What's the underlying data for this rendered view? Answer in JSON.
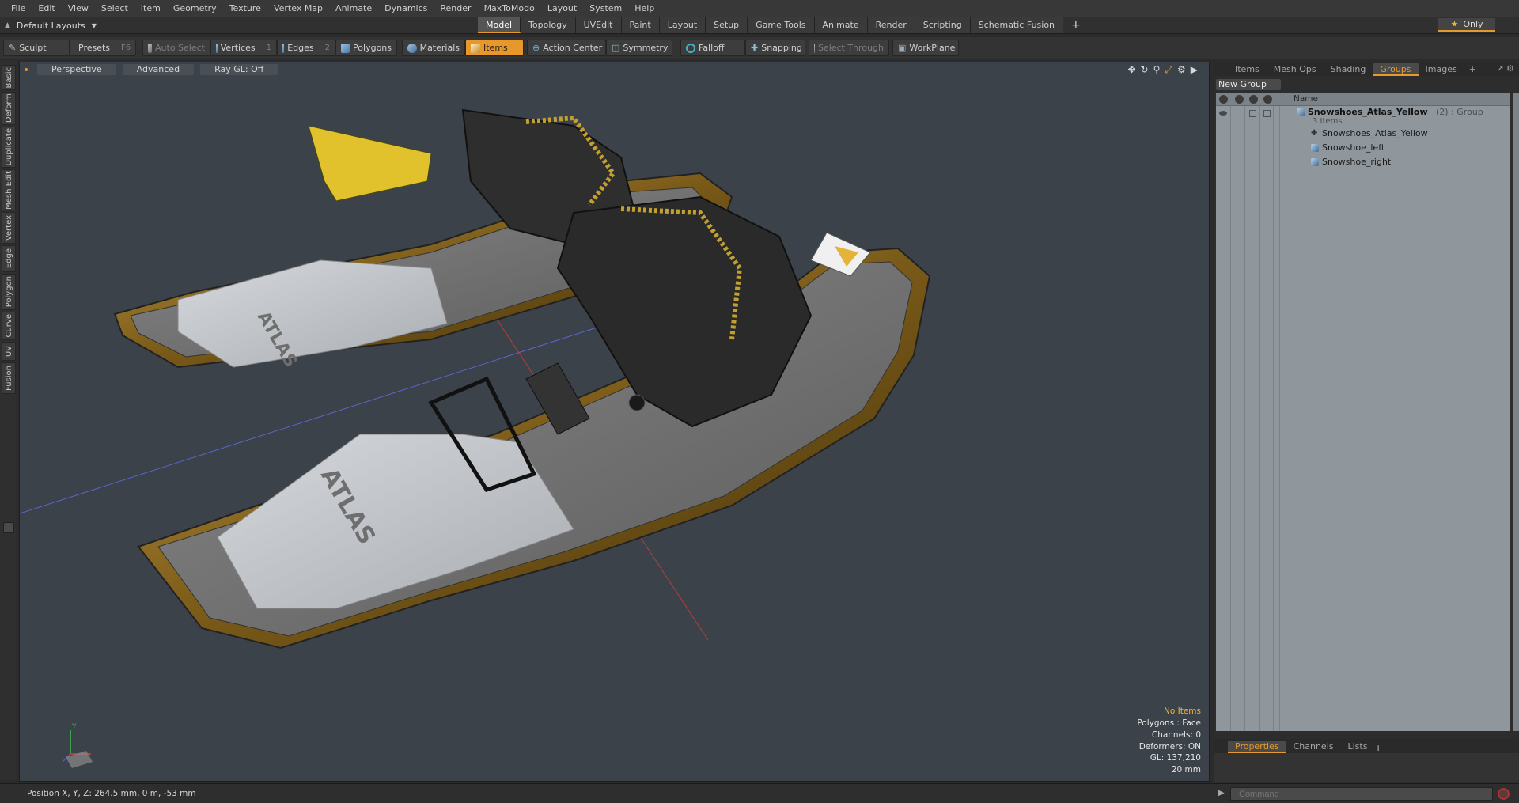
{
  "menu": [
    "File",
    "Edit",
    "View",
    "Select",
    "Item",
    "Geometry",
    "Texture",
    "Vertex Map",
    "Animate",
    "Dynamics",
    "Render",
    "MaxToModo",
    "Layout",
    "System",
    "Help"
  ],
  "layout": {
    "dropdown_label": "Default Layouts",
    "tabs": [
      "Model",
      "Topology",
      "UVEdit",
      "Paint",
      "Layout",
      "Setup",
      "Game Tools",
      "Animate",
      "Render",
      "Scripting",
      "Schematic Fusion"
    ],
    "active_tab": "Model",
    "add_tab": "+",
    "only_label": "Only"
  },
  "toolbar": {
    "sculpt": "Sculpt",
    "presets": "Presets",
    "presets_key": "F6",
    "auto_select": "Auto Select",
    "vertices": "Vertices",
    "vertices_key": "1",
    "edges": "Edges",
    "edges_key": "2",
    "polygons": "Polygons",
    "materials": "Materials",
    "items": "Items",
    "action_center": "Action Center",
    "symmetry": "Symmetry",
    "falloff": "Falloff",
    "snapping": "Snapping",
    "select_through": "Select Through",
    "workplane": "WorkPlane"
  },
  "left_tabs": [
    "Basic",
    "Deform",
    "Duplicate",
    "Mesh Edit",
    "Vertex",
    "Edge",
    "Polygon",
    "Curve",
    "UV",
    "Fusion"
  ],
  "viewport": {
    "view_mode": "Perspective",
    "shading": "Advanced",
    "raygl": "Ray GL: Off",
    "info": {
      "selection": "No Items",
      "polygons": "Polygons : Face",
      "channels": "Channels: 0",
      "deformers": "Deformers: ON",
      "gl": "GL: 137,210",
      "grid": "20 mm"
    },
    "axis_label": "Y"
  },
  "right_panel": {
    "tabs": [
      "Items",
      "Mesh Ops",
      "Shading",
      "Groups",
      "Images"
    ],
    "active_tab": "Groups",
    "add": "+",
    "new_group": "New Group",
    "column_name": "Name",
    "group": {
      "name": "Snowshoes_Atlas_Yellow",
      "count_suffix": "(2) : Group",
      "items_label": "3 Items",
      "children": [
        "Snowshoes_Atlas_Yellow",
        "Snowshoe_left",
        "Snowshoe_right"
      ]
    },
    "bottom_tabs": [
      "Properties",
      "Channels",
      "Lists"
    ],
    "bottom_active": "Properties"
  },
  "status": {
    "position": "Position X, Y, Z:   264.5 mm, 0 m, -53 mm",
    "command_placeholder": "Command"
  },
  "colors": {
    "accent": "#e8972a",
    "viewport_bg": "#3b4249",
    "list_bg": "#8f969c"
  }
}
